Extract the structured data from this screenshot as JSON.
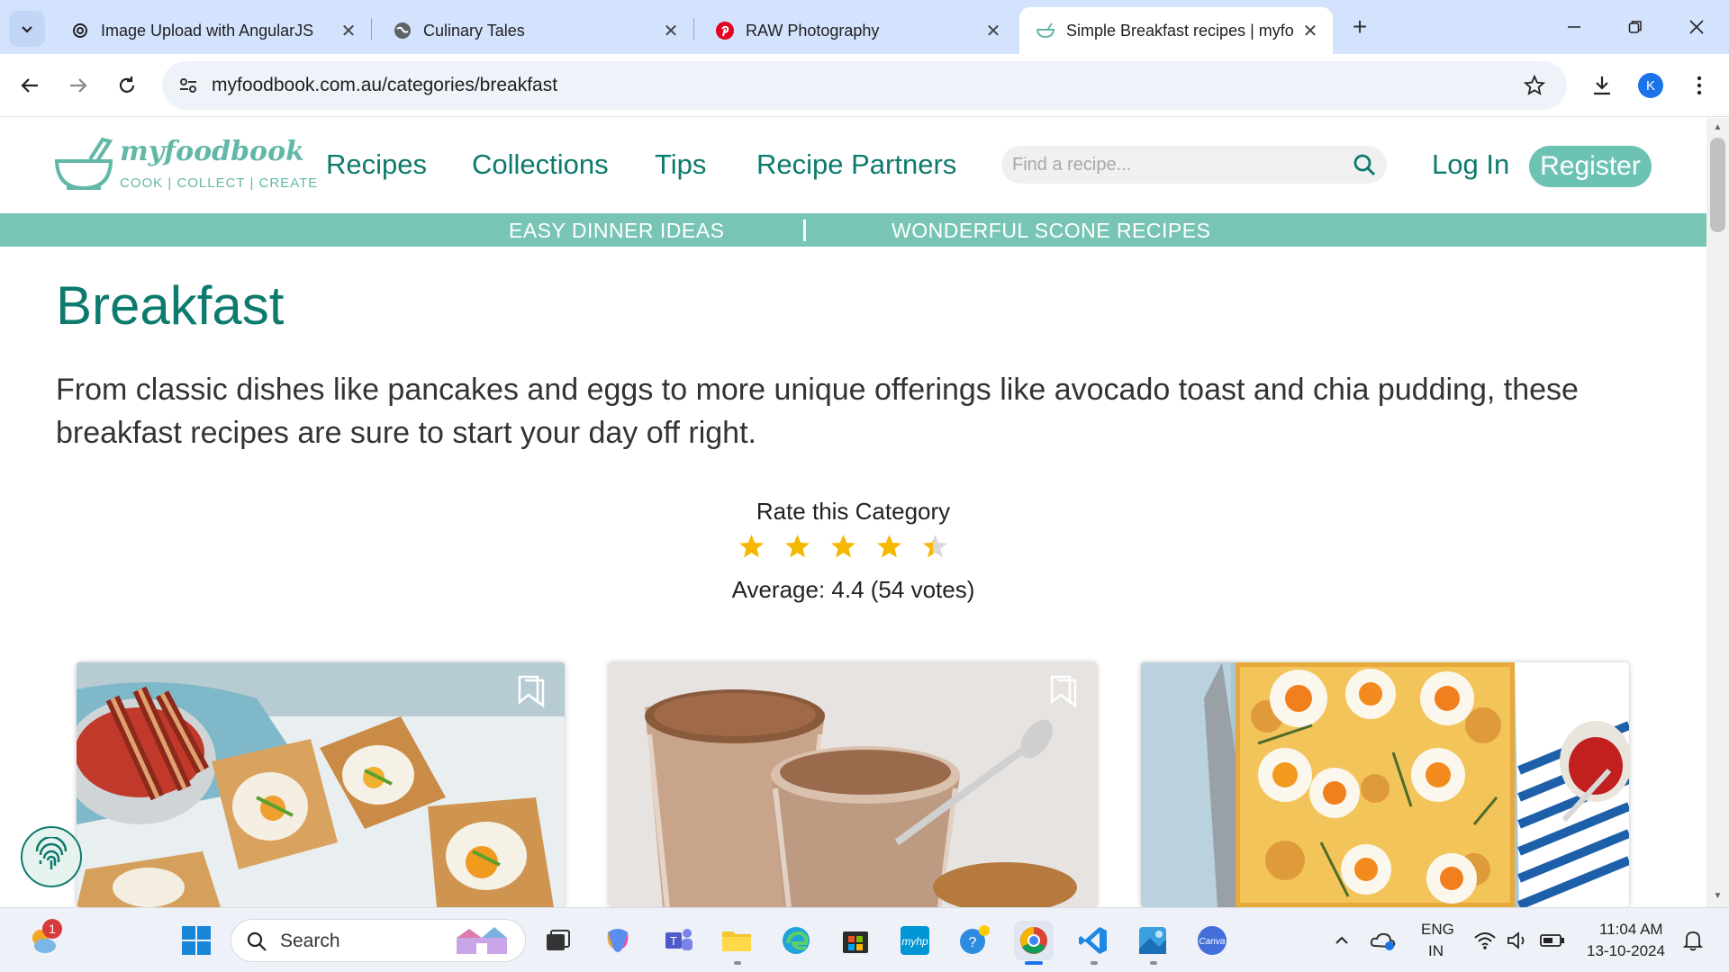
{
  "browser": {
    "tabs": [
      {
        "title": "Image Upload with AngularJS",
        "icon": "openai-icon",
        "active": false
      },
      {
        "title": "Culinary Tales",
        "icon": "globe-icon",
        "active": false
      },
      {
        "title": "RAW Photography",
        "icon": "pinterest-icon",
        "active": false
      },
      {
        "title": "Simple Breakfast recipes | myfo",
        "icon": "myfoodbook-icon",
        "active": true
      }
    ],
    "url": "myfoodbook.com.au/categories/breakfast",
    "profile_initial": "K"
  },
  "site": {
    "logo": {
      "word": "myfoodbook",
      "tagline": "COOK | COLLECT | CREATE"
    },
    "nav": [
      "Recipes",
      "Collections",
      "Tips",
      "Recipe Partners"
    ],
    "search_placeholder": "Find a recipe...",
    "login": "Log In",
    "register": "Register",
    "promo": [
      "EASY DINNER IDEAS",
      "WONDERFUL SCONE RECIPES"
    ]
  },
  "page": {
    "title": "Breakfast",
    "intro": "From classic dishes like pancakes and eggs to more unique offerings like avocado toast and chia pudding, these breakfast recipes are sure to start your day off right.",
    "rating": {
      "label": "Rate this Category",
      "value": 4.4,
      "max": 5,
      "average_text": "Average: 4.4 (54 votes)"
    },
    "cards": [
      {
        "image": "bacon-egg-toast-cups-photo"
      },
      {
        "image": "chocolate-milkshake-glasses-photo"
      },
      {
        "image": "egg-breakfast-pizza-photo"
      }
    ]
  },
  "taskbar": {
    "search_label": "Search",
    "notification_count": "1",
    "lang": "ENG",
    "region": "IN",
    "time": "11:04 AM",
    "date": "13-10-2024"
  },
  "colors": {
    "brand": "#0c7a6c",
    "brand_light": "#79c5b5",
    "star": "#f5b800"
  }
}
